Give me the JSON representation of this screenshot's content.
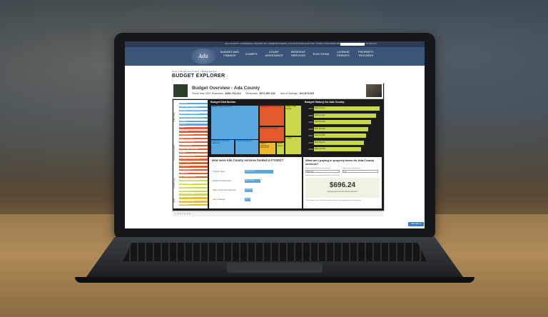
{
  "topbar": {
    "links": "ADA COUNTY HOMEPAGE | BOARD OF COMMISSIONERS | ACCOUNTING/AUDITOR | PUBLIC RECORDS REQUEST | ADA COUNTY | CONTACT",
    "search_placeholder": "Search"
  },
  "nav": {
    "logo_text": "Ada County",
    "items": [
      "BUDGET AND FINANCE",
      "COURTS",
      "COURT ASSISTANCE",
      "RESIDENT SERVICES",
      "ELECTIONS",
      "LICENSE PERMITS",
      "PROPERTY RECORDS"
    ]
  },
  "breadcrumb": "Home > Budget and Finance > Budget Explorer",
  "page_title": "BUDGET EXPLORER",
  "dashboard": {
    "title": "Budget Overview - Ada County",
    "fiscal_year": "Fiscal Year 2021",
    "expenses_label": "Expenses:",
    "expenses_value": "$284,731,212",
    "revenues_label": "Revenues:",
    "revenues_value": "$271,857,193",
    "savings_label": "Use of Savings:",
    "savings_value": "$12,874,019",
    "distribution_title": "Budget Distribution",
    "history_title": "Budget History for Ada County",
    "history_years": [
      "2021",
      "2020",
      "2019",
      "2018",
      "2017",
      "2016",
      "2015"
    ],
    "history_values": [
      "$284,731,212",
      "$268,424,921",
      "$246,513,222",
      "$235,018,449",
      "$226,412,901",
      "$216,381,812",
      "$204,334,788"
    ],
    "funded_title": "How were Ada County  services funded in FY2021?",
    "funded_labels": [
      "Property Taxes",
      "Department Revenues",
      "Other Government Agencies",
      "Use of Savings"
    ],
    "funded_values": [
      "$148,662,000",
      "$82,713,029",
      "$40,482,164",
      "$12,874,019"
    ],
    "tax_title": "What am I paying in property taxes for Ada County services?",
    "tax_label_1": "Home Value ($500 for assessment)*",
    "tax_label_2": "Home Owner's Exemption",
    "tax_input_1": "$300,000",
    "tax_input_2": "Yes",
    "tax_note": "*Market value is reduced by $100,000 up to $100,000",
    "tax_value": "$696.24",
    "tax_sub": "property taxes for Ada County Services*",
    "tax_foot": "*This estimate is not a final bill and does not include taxes levied by other taxing districts."
  },
  "sidebar": {
    "tabs": [
      "Public Safety",
      "General Government",
      "Judicial/Legal",
      "Other"
    ],
    "rows": [
      "ASSESSOR",
      "COURT TRIAL TRANSPORT",
      "EMERGENCY COMMUNICATIONS",
      "EMERGENCY MANAGEMENT",
      "EMERGENCY MEDICAL SERVICES",
      "JUVENILE",
      "SHERIFF",
      "ADMIN",
      "ELECTIONS",
      "CLERK'S AUDITOR",
      "BOARD OF COUNTY",
      "INDIGENT SERVICES",
      "COMMISSIONERS",
      "DEVELOPMENT SERVICES",
      "FINANCE",
      "HUMAN RESOURCES",
      "INFORMATION TECHNOLOGY",
      "MOTOR VEHICLE",
      "OPERATIONS",
      "PROCUREMENT",
      "TREASURER",
      "911 COMMUNICATIONS",
      "COMMUNITY SUPERVISION",
      "PUBLIC DEFENDER",
      "PROSECUTOR",
      "PUBLIC HEALTH",
      "TRIAL COURT ADMIN",
      "WEED CONTROL",
      "PARKS & WATERWAYS",
      "SOLID WASTE"
    ],
    "row_colors": [
      "#5aa7e0",
      "#5aa7e0",
      "#5aa7e0",
      "#5aa7e0",
      "#5aa7e0",
      "#5aa7e0",
      "#5aa7e0",
      "#e2592d",
      "#e2592d",
      "#e2592d",
      "#e2592d",
      "#e2592d",
      "#e2592d",
      "#e2592d",
      "#e2592d",
      "#e2592d",
      "#e2592d",
      "#e2592d",
      "#e2592d",
      "#e2592d",
      "#e2592d",
      "#e2592d",
      "#c8d84a",
      "#c8d84a",
      "#c8d84a",
      "#c8d84a",
      "#c8d84a",
      "#f0b82e",
      "#f0b82e",
      "#f0b82e"
    ]
  },
  "treemap": {
    "cells": [
      "SHERIFF $61,763,119 21.7%",
      "ASSESSOR $31,781,400 11%",
      "ADMIN $10,718,919 3.8%",
      "EMERGENCY MEDICAL SERVICES",
      "JUVENILE $5,980,081",
      "PUBLIC DEFENDER $14,900,000",
      "TRIAL COURT ADMIN",
      "SOLID WASTE",
      "OTHER"
    ],
    "cell_colors": [
      "#5aa7e0",
      "#e2592d",
      "#e2592d",
      "#5aa7e0",
      "#5aa7e0",
      "#f0b82e",
      "#c8d84a",
      "#c8d84a",
      "#c8d84a"
    ]
  },
  "footer": {
    "tableau": "+ a b | e a u",
    "chat": "Chat with us"
  }
}
